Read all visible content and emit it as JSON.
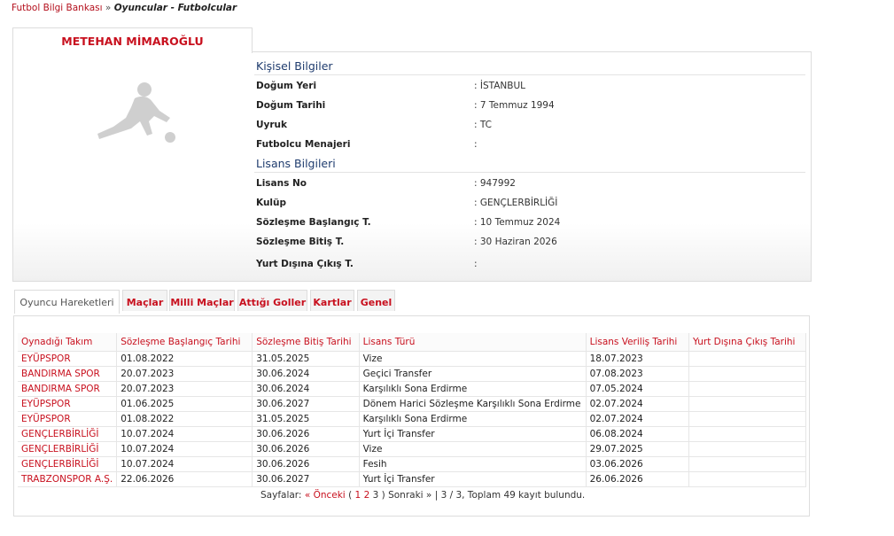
{
  "breadcrumb": {
    "home": "Futbol Bilgi Bankası",
    "separator": "»",
    "current": "Oyuncular - Futbolcular"
  },
  "player": {
    "name": "METEHAN MİMAROĞLU"
  },
  "personal": {
    "title": "Kişisel Bilgiler",
    "rows": [
      {
        "label": "Doğum Yeri",
        "value": ":  İSTANBUL"
      },
      {
        "label": "Doğum Tarihi",
        "value": ":  7 Temmuz 1994"
      },
      {
        "label": "Uyruk",
        "value": ":  TC"
      },
      {
        "label": "Futbolcu Menajeri",
        "value": ":"
      }
    ]
  },
  "license": {
    "title": "Lisans Bilgileri",
    "rows": [
      {
        "label": "Lisans No",
        "value": ": 947992"
      },
      {
        "label": "Kulüp",
        "value": ": GENÇLERBİRLİĞİ"
      },
      {
        "label": "Sözleşme Başlangıç T.",
        "value": ": 10 Temmuz 2024"
      },
      {
        "label": "Sözleşme Bitiş T.",
        "value": ": 30 Haziran 2026"
      },
      {
        "label": "Yurt Dışına Çıkış T.",
        "value": ":"
      }
    ]
  },
  "tabs": [
    "Oyuncu Hareketleri",
    "Maçlar",
    "Milli Maçlar",
    "Attığı Goller",
    "Kartlar",
    "Genel"
  ],
  "table": {
    "headers": [
      "Oynadığı Takım",
      "Sözleşme Başlangıç Tarihi",
      "Sözleşme Bitiş Tarihi",
      "Lisans Türü",
      "Lisans Veriliş Tarihi",
      "Yurt Dışına Çıkış Tarihi"
    ],
    "rows": [
      [
        "EYÜPSPOR",
        "01.08.2022",
        "31.05.2025",
        "Vize",
        "18.07.2023",
        ""
      ],
      [
        "BANDIRMA SPOR",
        "20.07.2023",
        "30.06.2024",
        "Geçici Transfer",
        "07.08.2023",
        ""
      ],
      [
        "BANDIRMA SPOR",
        "20.07.2023",
        "30.06.2024",
        "Karşılıklı Sona Erdirme",
        "07.05.2024",
        ""
      ],
      [
        "EYÜPSPOR",
        "01.06.2025",
        "30.06.2027",
        "Dönem Harici Sözleşme Karşılıklı Sona Erdirme",
        "02.07.2024",
        ""
      ],
      [
        "EYÜPSPOR",
        "01.08.2022",
        "31.05.2025",
        "Karşılıklı Sona Erdirme",
        "02.07.2024",
        ""
      ],
      [
        "GENÇLERBİRLİĞİ",
        "10.07.2024",
        "30.06.2026",
        "Yurt İçi Transfer",
        "06.08.2024",
        ""
      ],
      [
        "GENÇLERBİRLİĞİ",
        "10.07.2024",
        "30.06.2026",
        "Vize",
        "29.07.2025",
        ""
      ],
      [
        "GENÇLERBİRLİĞİ",
        "10.07.2024",
        "30.06.2026",
        "Fesih",
        "03.06.2026",
        ""
      ],
      [
        "TRABZONSPOR A.Ş.",
        "22.06.2026",
        "30.06.2027",
        "Yurt İçi Transfer",
        "26.06.2026",
        ""
      ]
    ]
  },
  "pager": {
    "label": "Sayfalar:",
    "prev": "« Önceki",
    "open_paren": "(",
    "pages": [
      "1",
      "2",
      "3"
    ],
    "close_paren": ")",
    "next": "Sonraki »",
    "summary": "| 3 / 3, Toplam 49 kayıt bulundu."
  },
  "colors": {
    "accent": "#c8101e",
    "section_title": "#1f3c6e"
  },
  "icons": {
    "photo": "player-silhouette-icon"
  }
}
